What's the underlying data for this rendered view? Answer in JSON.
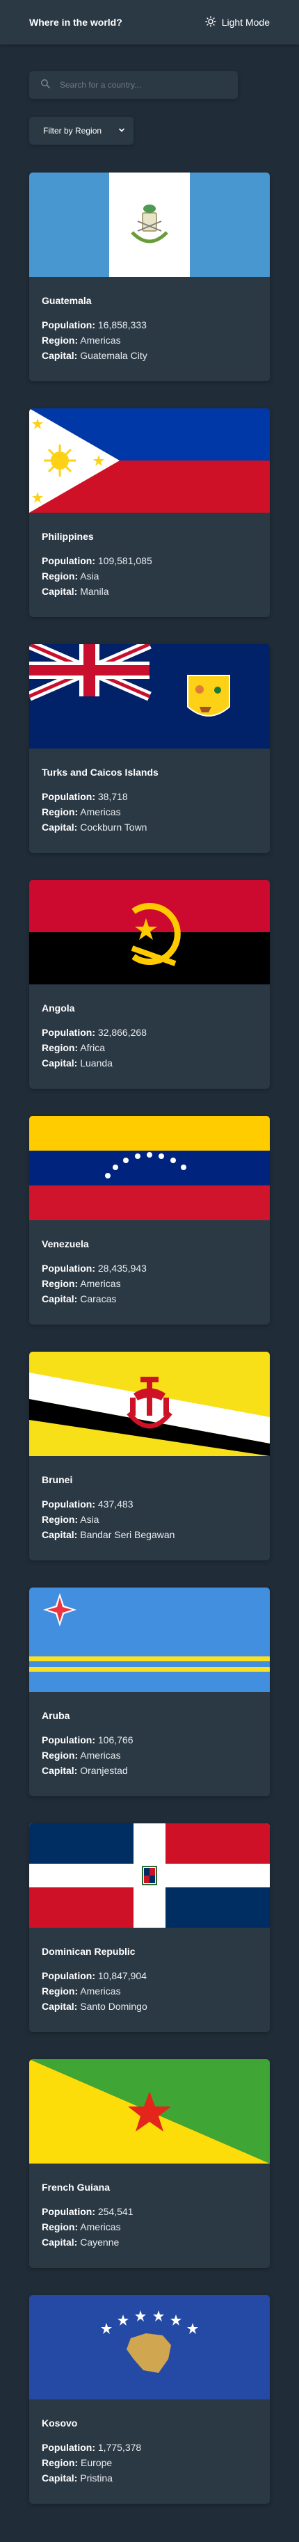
{
  "header": {
    "title": "Where in the world?",
    "theme_toggle_label": "Light Mode"
  },
  "search": {
    "placeholder": "Search for a country..."
  },
  "filter": {
    "label": "Filter by Region"
  },
  "labels": {
    "population": "Population:",
    "region": "Region:",
    "capital": "Capital:"
  },
  "countries": [
    {
      "name": "Guatemala",
      "population": "16,858,333",
      "region": "Americas",
      "capital": "Guatemala City"
    },
    {
      "name": "Philippines",
      "population": "109,581,085",
      "region": "Asia",
      "capital": "Manila"
    },
    {
      "name": "Turks and Caicos Islands",
      "population": "38,718",
      "region": "Americas",
      "capital": "Cockburn Town"
    },
    {
      "name": "Angola",
      "population": "32,866,268",
      "region": "Africa",
      "capital": "Luanda"
    },
    {
      "name": "Venezuela",
      "population": "28,435,943",
      "region": "Americas",
      "capital": "Caracas"
    },
    {
      "name": "Brunei",
      "population": "437,483",
      "region": "Asia",
      "capital": "Bandar Seri Begawan"
    },
    {
      "name": "Aruba",
      "population": "106,766",
      "region": "Americas",
      "capital": "Oranjestad"
    },
    {
      "name": "Dominican Republic",
      "population": "10,847,904",
      "region": "Americas",
      "capital": "Santo Domingo"
    },
    {
      "name": "French Guiana",
      "population": "254,541",
      "region": "Americas",
      "capital": "Cayenne"
    },
    {
      "name": "Kosovo",
      "population": "1,775,378",
      "region": "Europe",
      "capital": "Pristina"
    }
  ],
  "colors": {
    "background": "#202c37",
    "element": "#2b3945",
    "text": "#ffffff"
  }
}
